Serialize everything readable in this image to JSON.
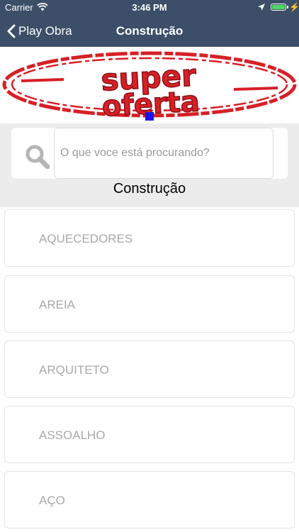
{
  "status_bar": {
    "carrier": "Carrier",
    "time": "3:46 PM"
  },
  "nav": {
    "back_label": "Play Obra",
    "title": "Construção"
  },
  "banner": {
    "line1": "super",
    "line2": "oferta",
    "accent_color": "#d62027"
  },
  "search": {
    "placeholder": "O que voce está procurando?",
    "value": ""
  },
  "section": {
    "title": "Construção"
  },
  "categories": [
    {
      "label": "AQUECEDORES"
    },
    {
      "label": "AREIA"
    },
    {
      "label": "ARQUITETO"
    },
    {
      "label": "ASSOALHO"
    },
    {
      "label": "AÇO"
    }
  ],
  "colors": {
    "nav_background": "#3d4f68",
    "page_indicator": "#1a14e6"
  }
}
